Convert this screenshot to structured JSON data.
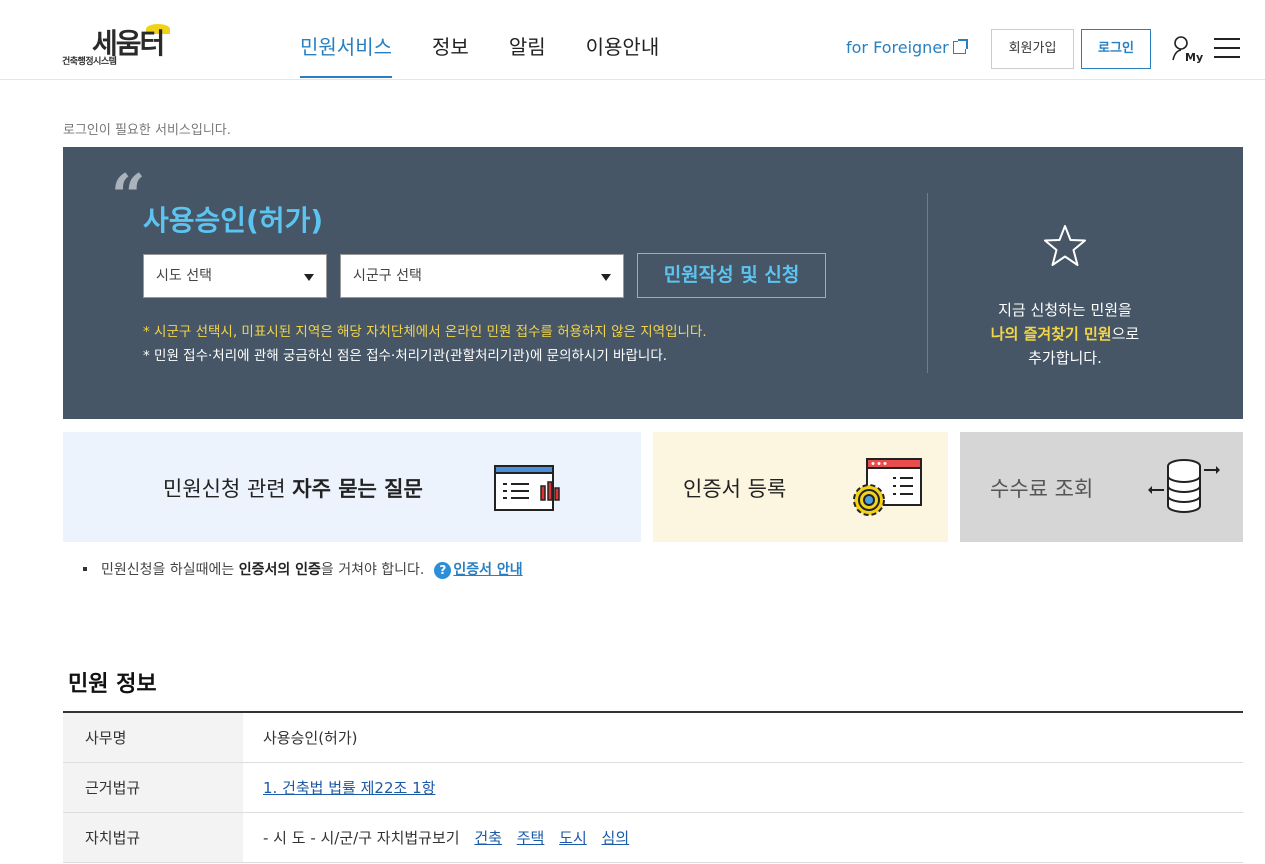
{
  "header": {
    "logo_main": "세움터",
    "logo_sub": "건축행정시스템",
    "nav": [
      {
        "label": "민원서비스",
        "active": true
      },
      {
        "label": "정보",
        "active": false
      },
      {
        "label": "알림",
        "active": false
      },
      {
        "label": "이용안내",
        "active": false
      }
    ],
    "foreigner_label": "for Foreigner",
    "join_label": "회원가입",
    "login_label": "로그인",
    "my_label": "My"
  },
  "notice": "로그인이 필요한 서비스입니다.",
  "hero": {
    "title": "사용승인(허가)",
    "sido_placeholder": "시도 선택",
    "sigungu_placeholder": "시군구 선택",
    "apply_label": "민원작성 및 신청",
    "note1": "* 시군구 선택시, 미표시된 지역은 해당 자치단체에서 온라인 민원 접수를 허용하지 않은 지역입니다.",
    "note2": "* 민원 접수·처리에 관해 궁금하신 점은 접수·처리기관(관할처리기관)에 문의하시기 바랍니다.",
    "fav_line1": "지금 신청하는 민원을",
    "fav_highlight": "나의 즐겨찾기 민원",
    "fav_suffix": "으로",
    "fav_line3": "추가합니다."
  },
  "cards": {
    "faq_prefix": "민원신청 관련 ",
    "faq_bold": "자주 묻는 질문",
    "cert_label": "인증서 등록",
    "fee_label": "수수료 조회"
  },
  "info": {
    "text1": "민원신청을 하실때에는 ",
    "bold": "인증서의 인증",
    "text2": "을 거쳐야 합니다.",
    "link": "인증서 안내"
  },
  "section": {
    "title": "민원 정보",
    "rows": [
      {
        "label": "사무명",
        "value": "사용승인(허가)"
      },
      {
        "label": "근거법규",
        "link": "1. 건축법 법률 제22조 1항"
      },
      {
        "label": "자치법규",
        "prefix": "- 시 도 - 시/군/구 자치법규보기",
        "links": [
          "건축",
          "주택",
          "도시",
          "심의"
        ]
      }
    ]
  },
  "colors": {
    "accent": "#2a7fc1",
    "hero_bg": "#465666",
    "hero_title": "#5cc4f0",
    "highlight": "#f3d54a"
  }
}
